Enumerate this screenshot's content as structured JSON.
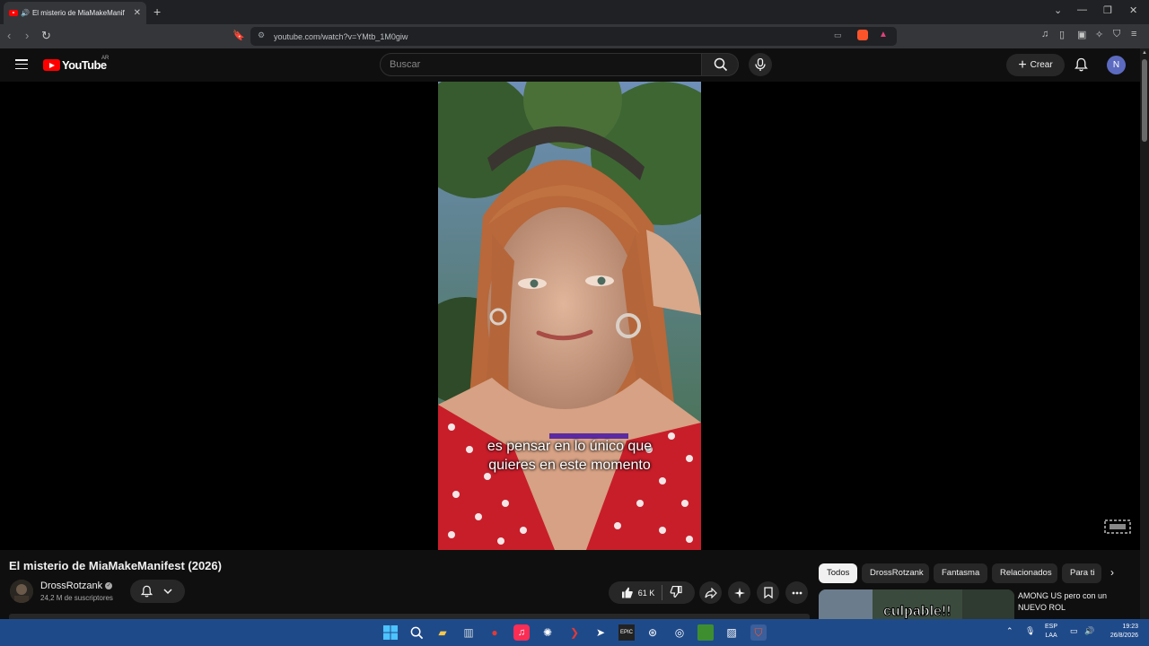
{
  "browser": {
    "tab_title": "El misterio de MiaMakeManif",
    "url": "youtube.com/watch?v=YMtb_1M0giw",
    "new_tab": "+",
    "close": "✕"
  },
  "youtube": {
    "logo_text": "YouTube",
    "country_code": "AR",
    "search_placeholder": "Buscar",
    "create_label": "Crear",
    "avatar_letter": "N"
  },
  "video": {
    "caption_line1": "es pensar en lo único que",
    "caption_line2": "quieres en este momento",
    "title": "El misterio de MiaMakeManifest (2026)",
    "channel_name": "DrossRotzank",
    "subscribers": "24,2 M de suscriptores",
    "likes": "61 K"
  },
  "chips": [
    "Todos",
    "DrossRotzank",
    "Fantasma",
    "Relacionados",
    "Para ti"
  ],
  "recommendation": {
    "thumb_text": "culpable!!",
    "title": "AMONG US pero con un NUEVO ROL"
  },
  "taskbar": {
    "lang": "ESP",
    "layout": "LAA",
    "time": "19:23",
    "date": "26/8/2026"
  },
  "colors": {
    "taskbar": "#1f4a8a",
    "youtube_red": "#ff0000",
    "background": "#0f0f0f"
  }
}
